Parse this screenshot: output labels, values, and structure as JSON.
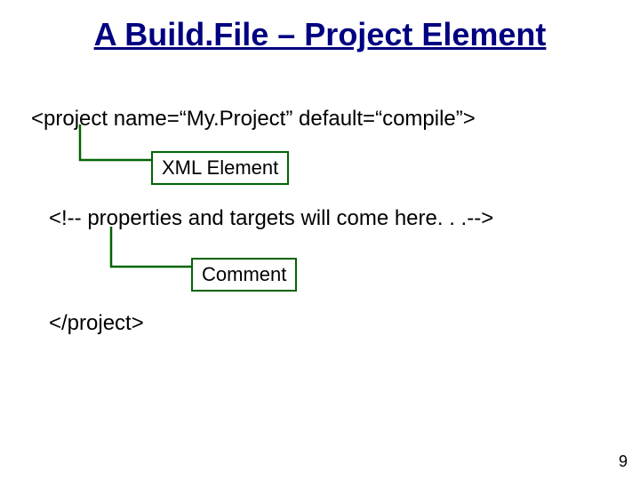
{
  "title": "A Build.File – Project Element",
  "code": {
    "open": "<project name=“My.Project” default=“compile”>",
    "comment": "<!-- properties and targets will come here. . .-->",
    "close": "</project>"
  },
  "labels": {
    "xml": "XML Element",
    "comment": "Comment"
  },
  "page": "9"
}
